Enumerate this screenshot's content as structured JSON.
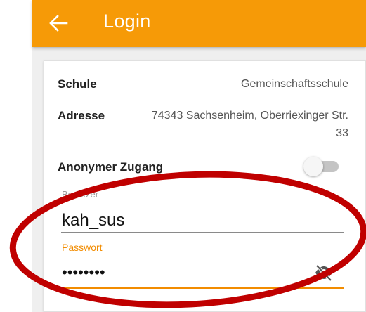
{
  "app_bar": {
    "title": "Login",
    "back_icon": "arrow-left-icon",
    "color": "#f69a07"
  },
  "school": {
    "label": "Schule",
    "value": "Gemeinschaftsschule"
  },
  "address": {
    "label": "Adresse",
    "line1": "74343 Sachsenheim, Oberriexinger Str.",
    "line2": "33"
  },
  "anonymous": {
    "label": "Anonymer Zugang",
    "enabled": false
  },
  "username": {
    "label": "Benutzer",
    "value": "kah_sus"
  },
  "password": {
    "label": "Passwort",
    "value": "••••••••",
    "toggle_icon": "eye-off-icon",
    "accent": "#f28c00"
  },
  "annotation": {
    "color": "#c00000",
    "shape": "ellipse"
  }
}
